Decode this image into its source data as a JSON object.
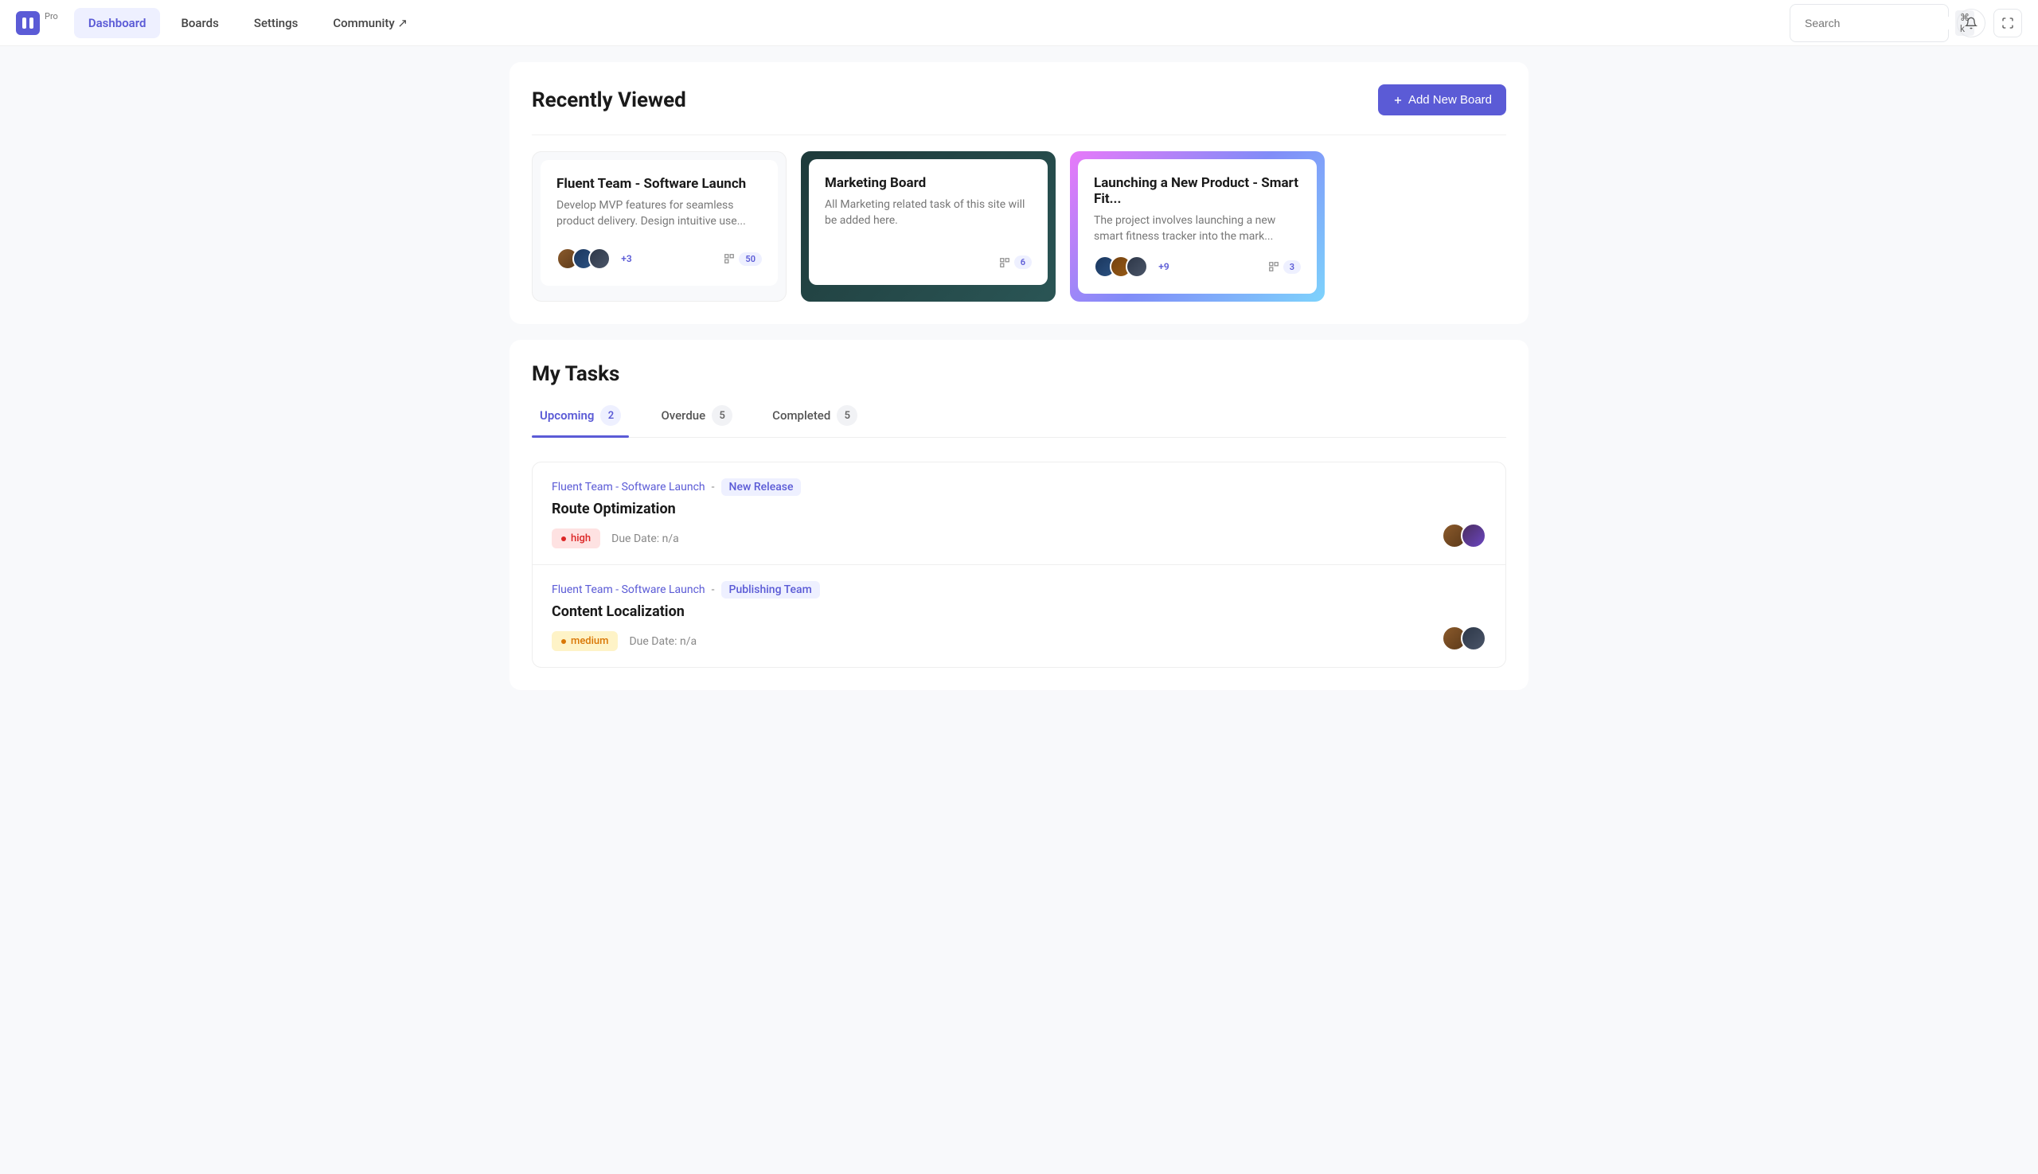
{
  "header": {
    "pro_label": "Pro",
    "nav": {
      "dashboard": "Dashboard",
      "boards": "Boards",
      "settings": "Settings",
      "community": "Community ↗"
    },
    "search_placeholder": "Search",
    "search_kbd": "⌘ k"
  },
  "recent": {
    "title": "Recently Viewed",
    "add_button": "Add New Board",
    "boards": [
      {
        "name": "Fluent Team - Software Launch",
        "desc": "Develop MVP features for seamless product delivery. Design intuitive use...",
        "more": "+3",
        "count": "50"
      },
      {
        "name": "Marketing Board",
        "desc": "All Marketing related task of this site will be added here.",
        "more": "",
        "count": "6"
      },
      {
        "name": "Launching a New Product - Smart Fit...",
        "desc": "The project involves launching a new smart fitness tracker into the mark...",
        "more": "+9",
        "count": "3"
      }
    ]
  },
  "tasks": {
    "title": "My Tasks",
    "tabs": {
      "upcoming": {
        "label": "Upcoming",
        "count": "2"
      },
      "overdue": {
        "label": "Overdue",
        "count": "5"
      },
      "completed": {
        "label": "Completed",
        "count": "5"
      }
    },
    "rows": [
      {
        "board": "Fluent Team - Software Launch",
        "sep": "-",
        "tag": "New Release",
        "title": "Route Optimization",
        "priority": "high",
        "due": "Due Date: n/a"
      },
      {
        "board": "Fluent Team - Software Launch",
        "sep": "-",
        "tag": "Publishing Team",
        "title": "Content Localization",
        "priority": "medium",
        "due": "Due Date: n/a"
      }
    ]
  }
}
